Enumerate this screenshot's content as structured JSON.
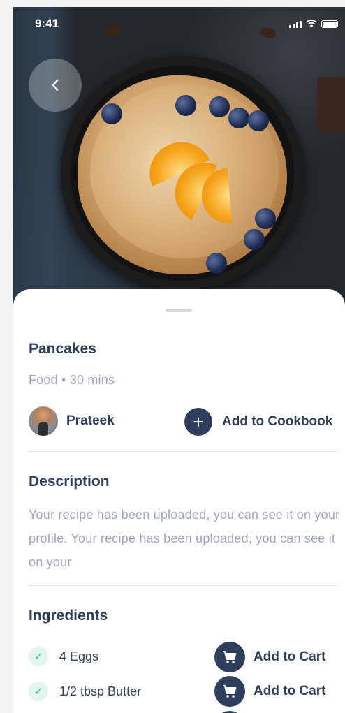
{
  "status_bar": {
    "time": "9:41"
  },
  "recipe": {
    "title": "Pancakes",
    "meta": "Food • 30 mins",
    "author": "Prateek",
    "add_to_cookbook": "Add to Cookbook"
  },
  "description": {
    "heading": "Description",
    "text": "Your recipe has been uploaded, you can see it on your profile. Your recipe has been uploaded, you can see it on your"
  },
  "ingredients": {
    "heading": "Ingredients",
    "items": [
      {
        "name": "4 Eggs",
        "action": "Add to Cart"
      },
      {
        "name": "1/2 tbsp Butter",
        "action": "Add to Cart"
      }
    ]
  },
  "colors": {
    "primary": "#2e3e5c",
    "muted": "#9fa5c0",
    "success": "#1fcc79"
  },
  "icons": [
    "back-chevron-icon",
    "plus-icon",
    "check-icon",
    "cart-icon",
    "signal-icon",
    "wifi-icon",
    "battery-icon"
  ]
}
